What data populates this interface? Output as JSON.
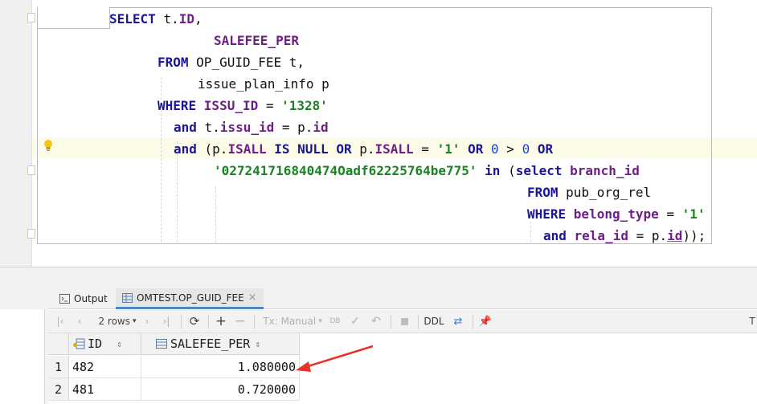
{
  "editor": {
    "lines": [
      {
        "parts": [
          {
            "t": "SELECT ",
            "c": "kw"
          },
          {
            "t": "t."
          },
          {
            "t": "ID",
            "c": "col"
          },
          {
            "t": ","
          }
        ]
      },
      {
        "parts": [
          {
            "t": "SALEFEE_PER",
            "c": "col"
          }
        ]
      },
      {
        "parts": [
          {
            "t": "FROM ",
            "c": "kw"
          },
          {
            "t": "OP_GUID_FEE t,"
          }
        ]
      },
      {
        "parts": [
          {
            "t": "issue_plan_info p"
          }
        ]
      },
      {
        "parts": [
          {
            "t": "WHERE ",
            "c": "kw"
          },
          {
            "t": "ISSU_ID",
            "c": "col"
          },
          {
            "t": " = "
          },
          {
            "t": "'1328'",
            "c": "str"
          }
        ]
      },
      {
        "parts": [
          {
            "t": "and ",
            "c": "kw"
          },
          {
            "t": "t."
          },
          {
            "t": "issu_id",
            "c": "col"
          },
          {
            "t": " = p."
          },
          {
            "t": "id",
            "c": "col"
          }
        ]
      },
      {
        "parts": [
          {
            "t": "and ",
            "c": "kw"
          },
          {
            "t": "(p."
          },
          {
            "t": "ISALL",
            "c": "col"
          },
          {
            "t": " "
          },
          {
            "t": "IS NULL OR ",
            "c": "kw"
          },
          {
            "t": "p."
          },
          {
            "t": "ISALL",
            "c": "col"
          },
          {
            "t": " = "
          },
          {
            "t": "'1'",
            "c": "str"
          },
          {
            "t": " "
          },
          {
            "t": "OR ",
            "c": "kw"
          },
          {
            "t": "0",
            "c": "num"
          },
          {
            "t": " > "
          },
          {
            "t": "0",
            "c": "num"
          },
          {
            "t": " "
          },
          {
            "t": "OR",
            "c": "kw"
          }
        ]
      },
      {
        "parts": [
          {
            "t": "'027241716840474Oadf62225764be775'",
            "c": "str"
          },
          {
            "t": " "
          },
          {
            "t": "in ",
            "c": "kw"
          },
          {
            "t": "("
          },
          {
            "t": "select ",
            "c": "kw"
          },
          {
            "t": "branch_id",
            "c": "col"
          }
        ]
      },
      {
        "parts": [
          {
            "t": "FROM ",
            "c": "kw"
          },
          {
            "t": "pub_org_rel"
          }
        ]
      },
      {
        "parts": [
          {
            "t": "WHERE ",
            "c": "kw"
          },
          {
            "t": "belong_type",
            "c": "col"
          },
          {
            "t": " = "
          },
          {
            "t": "'1'",
            "c": "str"
          }
        ]
      },
      {
        "parts": [
          {
            "t": "and ",
            "c": "kw"
          },
          {
            "t": "rela_id",
            "c": "col"
          },
          {
            "t": " = p."
          },
          {
            "t": "id",
            "c": "col u"
          },
          {
            "t": "));"
          }
        ]
      }
    ]
  },
  "results": {
    "tabs": [
      {
        "label": "Output",
        "icon": "output-icon"
      },
      {
        "label": "OMTEST.OP_GUID_FEE",
        "icon": "table-icon",
        "close": "×"
      }
    ],
    "toolbar": {
      "rows_label": "2 rows",
      "tx_label": "Tx: Manual",
      "ddl_label": "DDL",
      "right_letter": "T"
    },
    "columns": [
      {
        "name": "ID",
        "icon": "key-column-icon"
      },
      {
        "name": "SALEFEE_PER"
      }
    ],
    "rows": [
      {
        "num": "1",
        "ID": "482",
        "SALEFEE_PER": "1.080000"
      },
      {
        "num": "2",
        "ID": "481",
        "SALEFEE_PER": "0.720000"
      }
    ],
    "sort_glyph": "⇕",
    "annotation": {
      "color": "#e8312a",
      "target": "SALEFEE_PER row 1"
    }
  }
}
